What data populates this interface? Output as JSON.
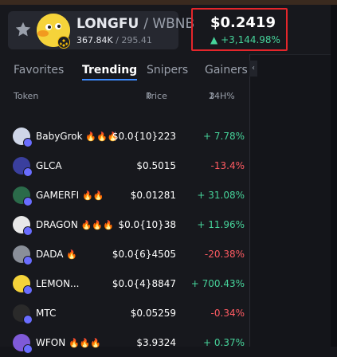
{
  "header": {
    "pair_base": "LONGFU",
    "pair_quote": "/ WBNB",
    "liquidity": "367.84K",
    "separator": "/",
    "secondary": "295.41",
    "price": "$0.2419",
    "change": "+3,144.98%",
    "accent_color": "#46d39a"
  },
  "tabs": [
    {
      "label": "Favorites"
    },
    {
      "label": "Trending"
    },
    {
      "label": "Snipers"
    },
    {
      "label": "Gainers"
    }
  ],
  "columns": {
    "token": "Token",
    "price": "Price",
    "change": "24H%"
  },
  "rows": [
    {
      "name": "BabyGrok",
      "fire": "🔥🔥🔥",
      "price": "$0.0{10}223",
      "change": "+ 7.78%",
      "dir": "pos",
      "color": "#cfd6e8"
    },
    {
      "name": "GLCA",
      "fire": "",
      "price": "$0.5015",
      "change": "-13.4%",
      "dir": "neg",
      "color": "#3a3f9e"
    },
    {
      "name": "GAMERFI",
      "fire": "🔥🔥",
      "price": "$0.01281",
      "change": "+ 31.08%",
      "dir": "pos",
      "color": "#2b6b4a"
    },
    {
      "name": "DRAGON",
      "fire": "🔥🔥🔥",
      "price": "$0.0{10}38",
      "change": "+ 11.96%",
      "dir": "pos",
      "color": "#e8e8e8"
    },
    {
      "name": "DADA",
      "fire": "🔥",
      "price": "$0.0{6}4505",
      "change": "-20.38%",
      "dir": "neg",
      "color": "#8a8f99"
    },
    {
      "name": "LEMON...",
      "fire": "",
      "price": "$0.0{4}8847",
      "change": "+ 700.43%",
      "dir": "pos",
      "color": "#f5d33a"
    },
    {
      "name": "MTC",
      "fire": "",
      "price": "$0.05259",
      "change": "-0.34%",
      "dir": "neg",
      "color": "#2a2a2a"
    },
    {
      "name": "WFON",
      "fire": "🔥🔥🔥",
      "price": "$3.9324",
      "change": "+ 0.37%",
      "dir": "pos",
      "color": "#7f5ad8"
    }
  ]
}
